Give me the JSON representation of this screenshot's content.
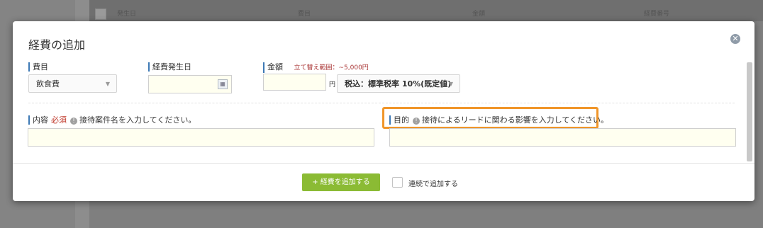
{
  "background": {
    "columns": [
      "発生日",
      "費目",
      "金額",
      "経費番号"
    ]
  },
  "modal": {
    "title": "経費の追加",
    "close_icon": "close-icon"
  },
  "fields": {
    "category": {
      "label": "費目",
      "value": "飲食費"
    },
    "date": {
      "label": "経費発生日",
      "value": ""
    },
    "amount": {
      "label": "金額",
      "hint": "立て替え範囲：~5,000円",
      "value": "",
      "unit": "円"
    },
    "tax": {
      "value": "税込：標準税率 10%(既定値)"
    },
    "content": {
      "label": "内容",
      "required": "必須",
      "help": "接待案件名を入力してください。",
      "value": ""
    },
    "purpose": {
      "label": "目的",
      "help": "接待によるリードに関わる影響を入力してください。",
      "value": ""
    }
  },
  "footer": {
    "add_button": "+ 経費を追加する",
    "continuous_label": "連続で追加する"
  },
  "colors": {
    "accent": "#3d79b5",
    "highlight": "#f0962a",
    "button": "#8bbb34",
    "input_bg": "#fffff0"
  }
}
